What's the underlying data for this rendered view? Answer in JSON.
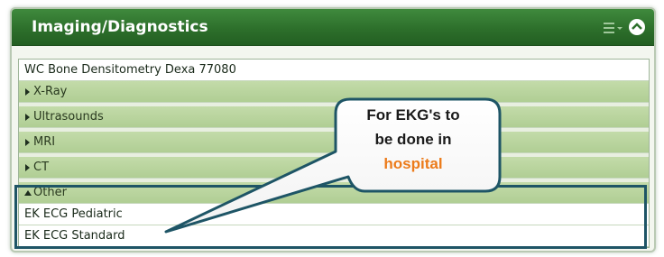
{
  "header": {
    "title": "Imaging/Diagnostics"
  },
  "icons": {
    "menu": "list-menu-icon",
    "collapse": "chevron-up-circle-icon"
  },
  "rows": [
    {
      "kind": "item",
      "label": "WC Bone Densitometry Dexa 77080"
    },
    {
      "kind": "group",
      "label": "X-Ray",
      "expanded": false
    },
    {
      "kind": "group",
      "label": "Ultrasounds",
      "expanded": false
    },
    {
      "kind": "group",
      "label": "MRI",
      "expanded": false
    },
    {
      "kind": "group",
      "label": "CT",
      "expanded": false
    },
    {
      "kind": "group",
      "label": "Other",
      "expanded": true
    },
    {
      "kind": "item",
      "label": "EK ECG Pediatric"
    },
    {
      "kind": "item",
      "label": "EK ECG Standard"
    }
  ],
  "callout": {
    "line1": "For EKG's to",
    "line2": "be done in",
    "line3": "hospital"
  },
  "colors": {
    "header_green": "#2d6f2b",
    "group_row": "#b0ce94",
    "highlight_border": "#1e5566",
    "callout_accent": "#ec7b1a"
  }
}
